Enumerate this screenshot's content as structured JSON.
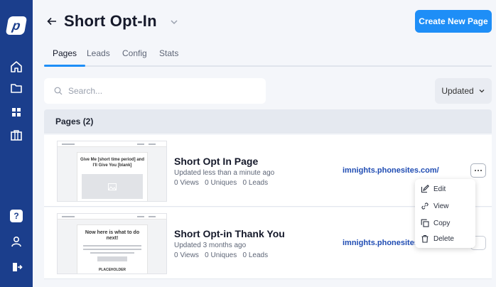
{
  "sidebar": {
    "logo_letter": "p",
    "icons": [
      "logo-icon",
      "home-icon",
      "folder-icon",
      "grid-icon",
      "bag-icon",
      "help-icon",
      "user-icon",
      "logout-icon"
    ],
    "help_label": "?"
  },
  "header": {
    "title": "Short Opt-In",
    "create_button": "Create New Page"
  },
  "tabs": [
    {
      "label": "Pages",
      "active": true
    },
    {
      "label": "Leads",
      "active": false
    },
    {
      "label": "Config",
      "active": false
    },
    {
      "label": "Stats",
      "active": false
    }
  ],
  "search": {
    "placeholder": "Search..."
  },
  "sort": {
    "label": "Updated"
  },
  "list": {
    "header": "Pages (2)",
    "rows": [
      {
        "title": "Short Opt In Page",
        "updated": "Updated less than a minute ago",
        "stats": "0 Views   0 Uniques   0 Leads",
        "url": "imnights.phonesites.com/",
        "thumb_heading": "Give Me [short time period] and I'll Give You [blank]"
      },
      {
        "title": "Short Opt-in Thank You",
        "updated": "Updated 3 months ago",
        "stats": "0 Views   0 Uniques   0 Leads",
        "url": "imnights.phonesites.c",
        "thumb_heading": "Now here is what to do next!",
        "thumb_logo": "PLACEHOLDER"
      }
    ]
  },
  "menu": {
    "items": [
      {
        "label": "Edit",
        "icon": "edit-icon"
      },
      {
        "label": "View",
        "icon": "link-icon"
      },
      {
        "label": "Copy",
        "icon": "copy-icon"
      },
      {
        "label": "Delete",
        "icon": "trash-icon"
      }
    ]
  },
  "colors": {
    "sidebar": "#1b3e8c",
    "accent": "#1e8ef7",
    "link": "#1f4cb3",
    "background": "#f4f6fa"
  }
}
